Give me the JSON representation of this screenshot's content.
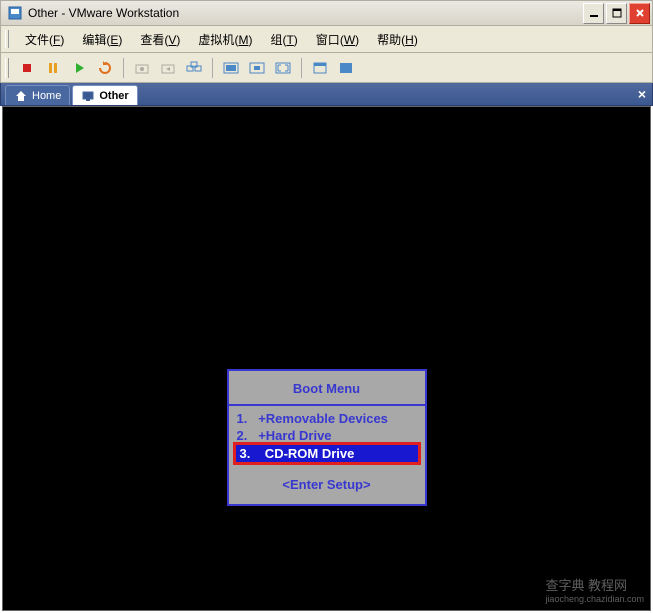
{
  "window": {
    "title": "Other - VMware Workstation"
  },
  "menus": [
    {
      "label": "文件",
      "accel": "F"
    },
    {
      "label": "编辑",
      "accel": "E"
    },
    {
      "label": "查看",
      "accel": "V"
    },
    {
      "label": "虚拟机",
      "accel": "M"
    },
    {
      "label": "组",
      "accel": "T"
    },
    {
      "label": "窗口",
      "accel": "W"
    },
    {
      "label": "帮助",
      "accel": "H"
    }
  ],
  "toolbar_icons": {
    "poweroff": "poweroff-icon",
    "suspend": "suspend-icon",
    "play": "play-icon",
    "reset": "reset-icon",
    "snapshot": "snapshot-icon",
    "revert": "revert-icon",
    "manage": "manage-snapshots-icon",
    "fullscreen1": "view-console-icon",
    "fullscreen2": "quick-switch-icon",
    "fullscreen3": "fullscreen-icon",
    "summary": "summary-icon",
    "console": "console-icon"
  },
  "tabs": [
    {
      "label": "Home",
      "active": false
    },
    {
      "label": "Other",
      "active": true
    }
  ],
  "bios": {
    "title": "Boot Menu",
    "items": [
      {
        "num": "1.",
        "label": "+Removable Devices",
        "selected": false
      },
      {
        "num": "2.",
        "label": "+Hard Drive",
        "selected": false
      },
      {
        "num": "3.",
        "label": " CD-ROM Drive",
        "selected": true
      }
    ],
    "footer": "<Enter Setup>"
  },
  "watermark": {
    "main": "查字典 教程网",
    "sub": "jiaocheng.chazidian.com"
  }
}
